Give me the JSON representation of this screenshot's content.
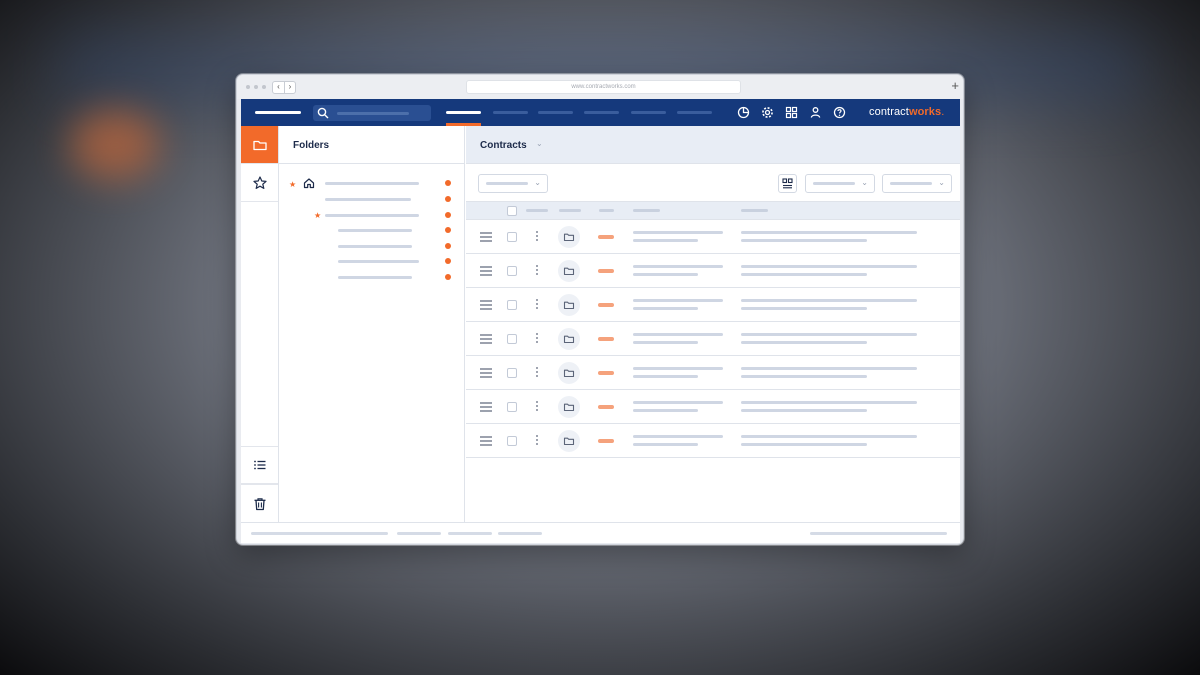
{
  "browser": {
    "url": "www.contractworks.com",
    "back_glyph": "‹",
    "forward_glyph": "›",
    "new_tab_glyph": "+"
  },
  "brand": {
    "name_part1": "contract",
    "name_part2": "works",
    "name_dot": ".",
    "accent_color": "#f26a2a",
    "nav_color": "#15397c"
  },
  "nav": {
    "active_tab_index": 0,
    "icons": [
      "clock-pie-icon",
      "gear-icon",
      "grid-apps-icon",
      "user-icon",
      "help-icon"
    ]
  },
  "rail": {
    "top_items": [
      "folder-icon",
      "star-icon"
    ],
    "bottom_items": [
      "list-icon",
      "trash-icon"
    ],
    "active": "folder-icon"
  },
  "folders": {
    "title": "Folders"
  },
  "main": {
    "title": "Contracts",
    "caret": "⌄"
  },
  "toolbar": {
    "caret": "⌄"
  }
}
